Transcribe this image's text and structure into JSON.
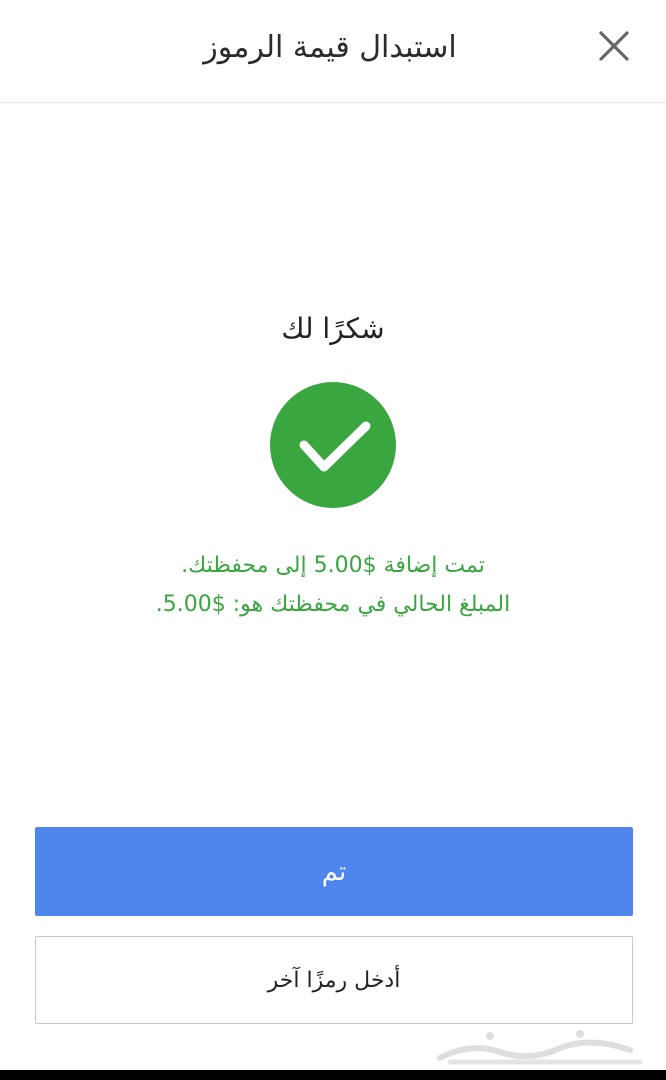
{
  "header": {
    "title": "استبدال قيمة الرموز"
  },
  "confirmation": {
    "thanks": "شكرًا لك",
    "message_line1": "تمت إضافة $5.00 إلى محفظتك.",
    "message_line2": "المبلغ الحالي في محفظتك هو: $5.00.",
    "success_color": "#3aa640"
  },
  "actions": {
    "done_label": "تم",
    "enter_another_label": "أدخل رمزًا آخر",
    "primary_color": "#4f86ed"
  },
  "icons": {
    "close": "close-icon",
    "success": "checkmark-icon",
    "watermark": "haraj-watermark-logo"
  },
  "watermark": {
    "text": "حراج"
  }
}
